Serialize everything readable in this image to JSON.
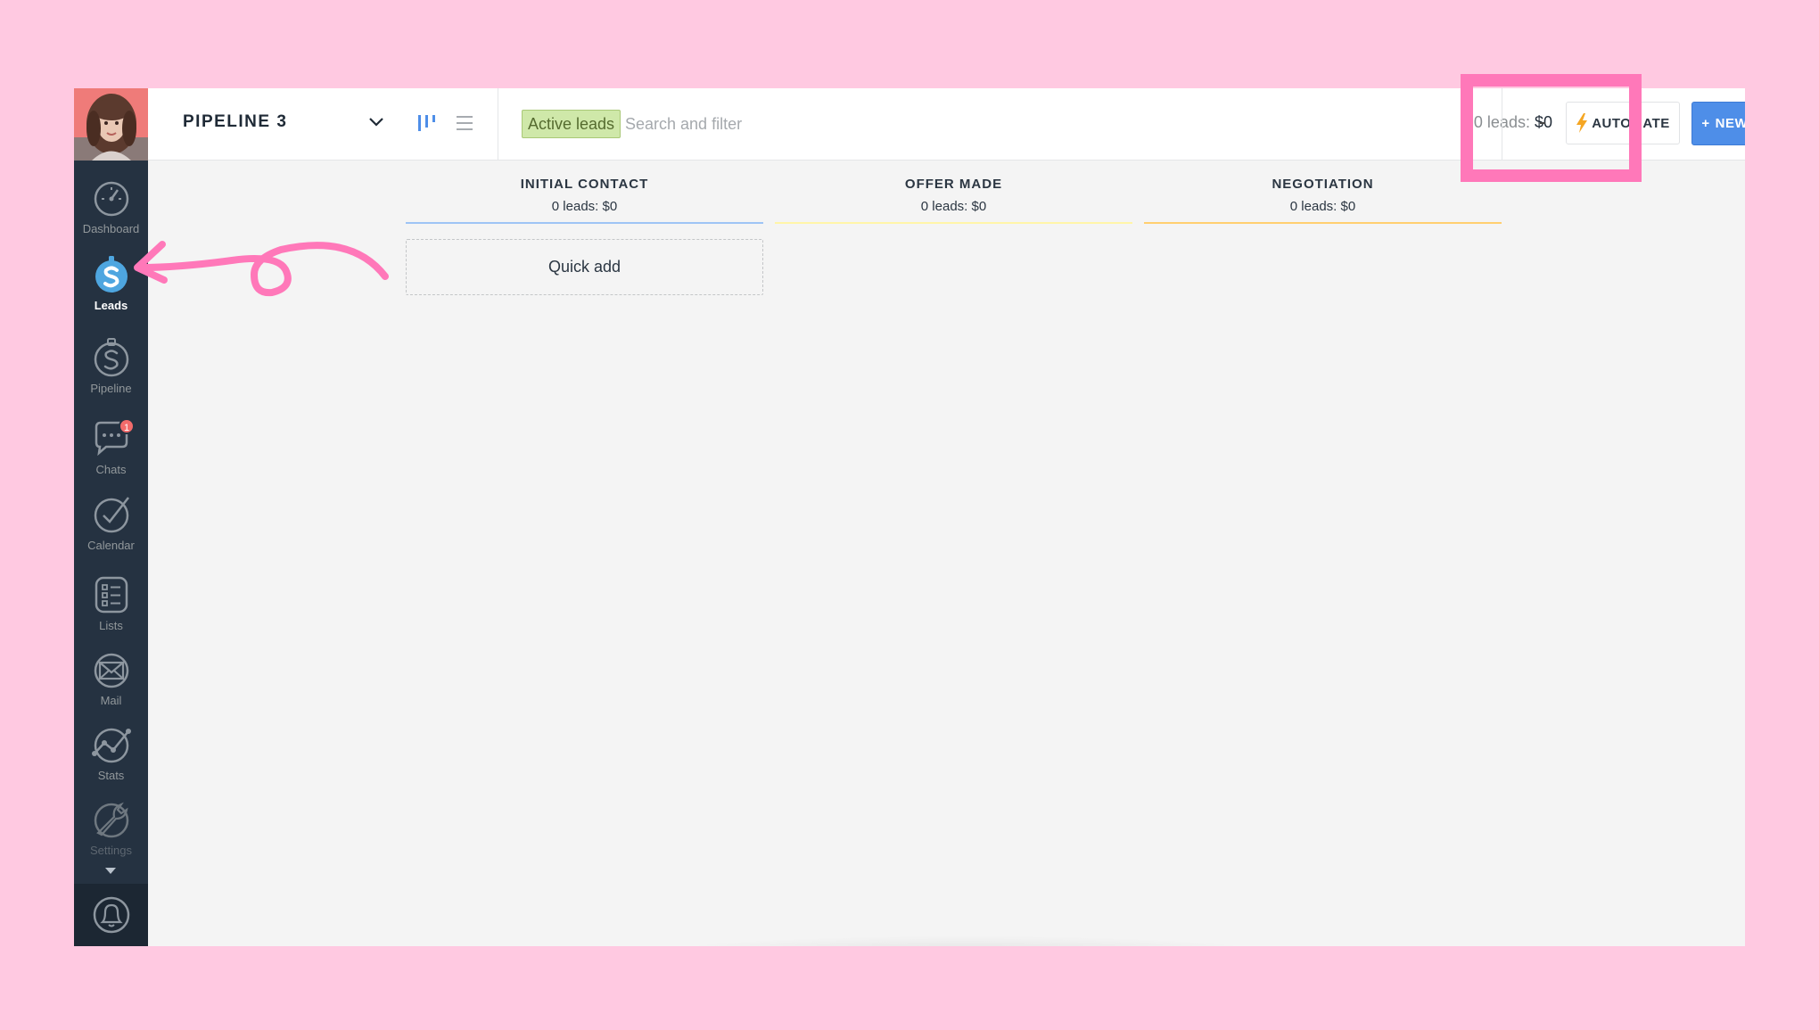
{
  "topbar": {
    "pipeline_title": "PIPELINE 3",
    "filter_tag": "Active leads",
    "search_placeholder": "Search and filter",
    "leads_count_label": "0 leads:",
    "leads_total": "$0",
    "automate_label": "AUTOMATE",
    "new_lead_plus": "+",
    "new_lead_label": "NEW LEAD"
  },
  "sidebar": {
    "items": [
      {
        "label": "Dashboard",
        "icon": "speedometer-icon"
      },
      {
        "label": "Leads",
        "icon": "dollar-icon"
      },
      {
        "label": "Pipeline",
        "icon": "dollar-outline-icon"
      },
      {
        "label": "Chats",
        "icon": "chat-icon",
        "badge": "1"
      },
      {
        "label": "Calendar",
        "icon": "checkmark-icon"
      },
      {
        "label": "Lists",
        "icon": "list-icon"
      },
      {
        "label": "Mail",
        "icon": "mail-icon"
      },
      {
        "label": "Stats",
        "icon": "stats-icon"
      },
      {
        "label": "Settings",
        "icon": "wrench-icon"
      }
    ],
    "notifications_icon": "bell-icon"
  },
  "columns": [
    {
      "title": "INITIAL CONTACT",
      "summary": "0 leads: $0",
      "color": "#9ec4f5"
    },
    {
      "title": "OFFER MADE",
      "summary": "0 leads: $0",
      "color": "#fff5a8"
    },
    {
      "title": "NEGOTIATION",
      "summary": "0 leads: $0",
      "color": "#ffcf70"
    }
  ],
  "quick_add_label": "Quick add",
  "colors": {
    "sidebar_bg": "#253241",
    "accent_blue": "#4e8ee8",
    "annotation_pink": "#ff78b9",
    "page_bg": "#ffc9e1"
  }
}
